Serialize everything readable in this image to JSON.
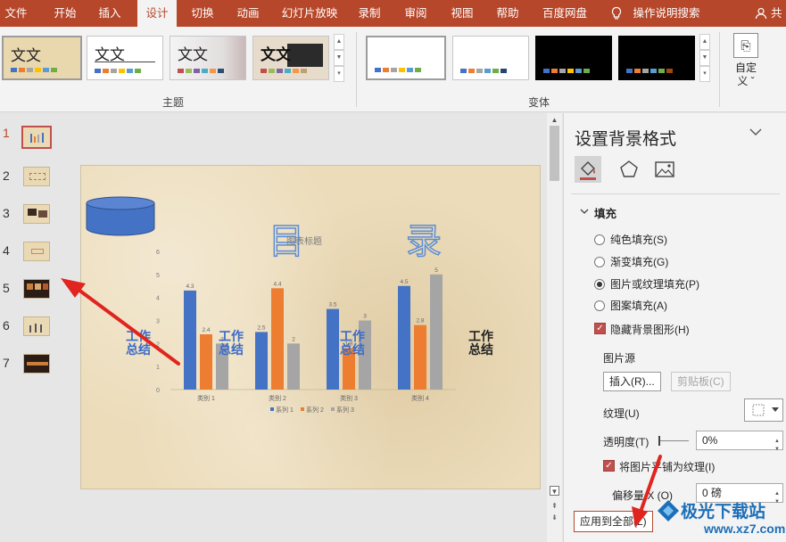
{
  "tabs": [
    "文件",
    "开始",
    "插入",
    "设计",
    "切换",
    "动画",
    "幻灯片放映",
    "录制",
    "审阅",
    "视图",
    "帮助",
    "百度网盘",
    "操作说明搜索"
  ],
  "active_tab": "设计",
  "share_label": "共享",
  "ribbon": {
    "theme_thumbs": [
      {
        "text": "文文",
        "selected": true
      },
      {
        "text": "文文",
        "selected": false
      },
      {
        "text": "文文",
        "selected": false
      },
      {
        "text": "文文",
        "selected": false
      }
    ],
    "variant_thumbs": [
      "white",
      "white",
      "black",
      "black"
    ],
    "group_themes": "主题",
    "group_variants": "变体",
    "customize_label": "自定义",
    "customize_line1": "自定",
    "customize_line2": "义 ˇ"
  },
  "slide_numbers": [
    "1",
    "2",
    "3",
    "4",
    "5",
    "6",
    "7"
  ],
  "active_slide": "1",
  "slide": {
    "title_left": "目",
    "title_right": "录",
    "side_left": "工作\n总结",
    "side_mid": "工作\n总结",
    "side_mid2": "工作\n总结",
    "side_right": "工作\n总结"
  },
  "chart_data": {
    "type": "bar",
    "title": "图表标题",
    "categories": [
      "类别 1",
      "类别 2",
      "类别 3",
      "类别 4"
    ],
    "series": [
      {
        "name": "系列 1",
        "color": "#4472c4",
        "values": [
          4.3,
          2.5,
          3.5,
          4.5
        ]
      },
      {
        "name": "系列 2",
        "color": "#ed7d31",
        "values": [
          2.4,
          4.4,
          1.8,
          2.8
        ]
      },
      {
        "name": "系列 3",
        "color": "#a5a5a5",
        "values": [
          2,
          2,
          3,
          5
        ]
      }
    ],
    "y_ticks": [
      "0",
      "1",
      "2",
      "3",
      "4",
      "5",
      "6"
    ],
    "ylim": [
      0,
      6
    ],
    "legend": "bottom"
  },
  "pane": {
    "title": "设置背景格式",
    "section_fill": "填充",
    "fill_options": [
      "纯色填充(S)",
      "渐变填充(G)",
      "图片或纹理填充(P)",
      "图案填充(A)"
    ],
    "selected_fill": "图片或纹理填充(P)",
    "hide_bg_graphics": "隐藏背景图形(H)",
    "picture_source": "图片源",
    "insert_button": "插入(R)...",
    "clipboard_button": "剪贴板(C)",
    "texture_label": "纹理(U)",
    "transparency_label": "透明度(T)",
    "transparency_value": "0%",
    "tile_label": "将图片平铺为纹理(I)",
    "offset_x_label": "偏移量 X (O)",
    "offset_x_value": "0 磅",
    "apply_all": "应用到全部(L)"
  },
  "watermark": {
    "line1": "极光下载站",
    "line2": "www.xz7.com"
  },
  "colors": {
    "accent": "#b7472a",
    "annotation_arrow": "#e0241f"
  }
}
